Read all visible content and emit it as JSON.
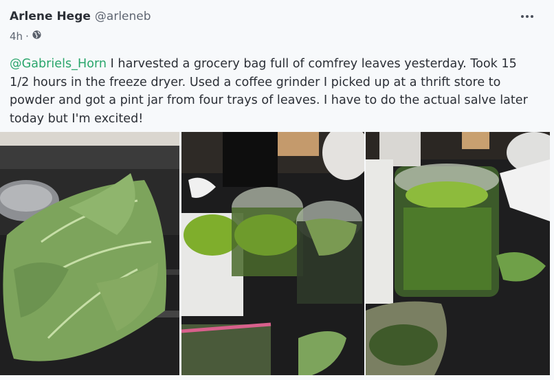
{
  "post": {
    "display_name": "Arlene Hege",
    "handle": "@arleneb",
    "time": "4h",
    "separator": "·",
    "visibility_icon": "globe-icon",
    "more_icon": "more-dots-icon",
    "mention": "@Gabriels_Horn",
    "text": " I harvested a grocery bag full of comfrey leaves yesterday. Took 15 1/2 hours in the freeze dryer. Used a coffee grinder I picked up at a thrift store to powder and got a pint jar from four trays of leaves. I have to do the actual salve later today but I'm excited!"
  },
  "colors": {
    "mention": "#2aa66c",
    "text": "#2b2f36",
    "muted": "#5f6672"
  }
}
